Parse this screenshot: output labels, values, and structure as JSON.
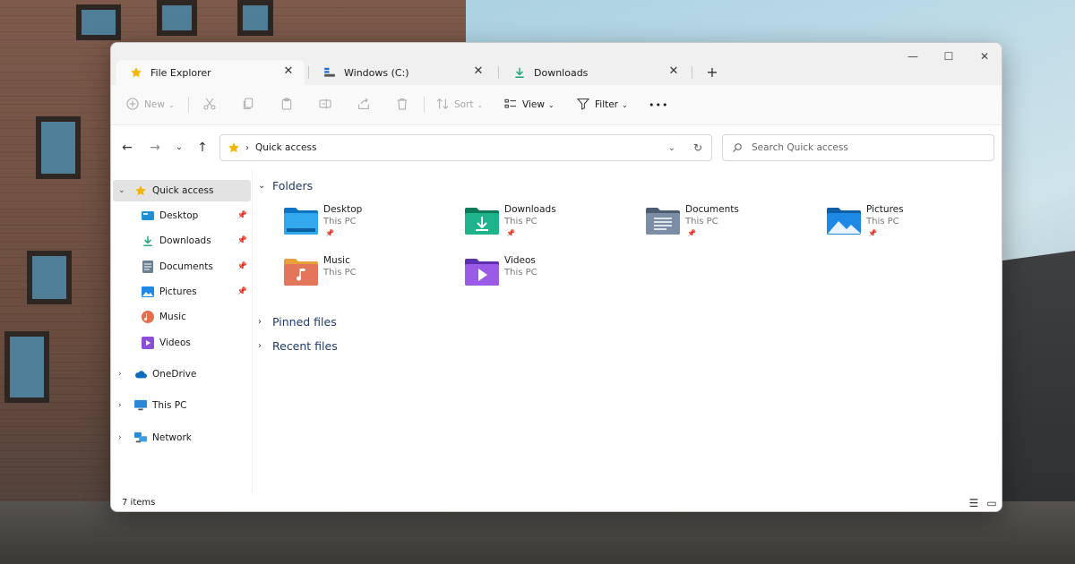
{
  "tabs": [
    {
      "label": "File Explorer",
      "icon": "star-icon"
    },
    {
      "label": "Windows (C:)",
      "icon": "drive-icon"
    },
    {
      "label": "Downloads",
      "icon": "download-icon"
    }
  ],
  "window_controls": {
    "minimize": "—",
    "maximize": "☐",
    "close": "✕"
  },
  "toolbar": {
    "new_label": "New",
    "sort_label": "Sort",
    "view_label": "View",
    "filter_label": "Filter",
    "more_label": "•••"
  },
  "address": {
    "path": "Quick access"
  },
  "search": {
    "placeholder": "Search Quick access"
  },
  "sidebar": {
    "quick_access": "Quick access",
    "pinned": [
      {
        "label": "Desktop"
      },
      {
        "label": "Downloads"
      },
      {
        "label": "Documents"
      },
      {
        "label": "Pictures"
      },
      {
        "label": "Music"
      },
      {
        "label": "Videos"
      }
    ],
    "onedrive": "OneDrive",
    "thispc": "This PC",
    "network": "Network"
  },
  "sections": {
    "folders": "Folders",
    "pinned_files": "Pinned files",
    "recent_files": "Recent files"
  },
  "folders": [
    {
      "name": "Desktop",
      "location": "This PC",
      "pinned": true,
      "color": "#1e90d6"
    },
    {
      "name": "Downloads",
      "location": "This PC",
      "pinned": true,
      "color": "#1aa37a"
    },
    {
      "name": "Documents",
      "location": "This PC",
      "pinned": true,
      "color": "#6d7f95"
    },
    {
      "name": "Pictures",
      "location": "This PC",
      "pinned": true,
      "color": "#1e88e5"
    },
    {
      "name": "Music",
      "location": "This PC",
      "pinned": false,
      "color": "#e46f4d"
    },
    {
      "name": "Videos",
      "location": "This PC",
      "pinned": false,
      "color": "#8a4fd6"
    }
  ],
  "status": {
    "items": "7 items"
  }
}
